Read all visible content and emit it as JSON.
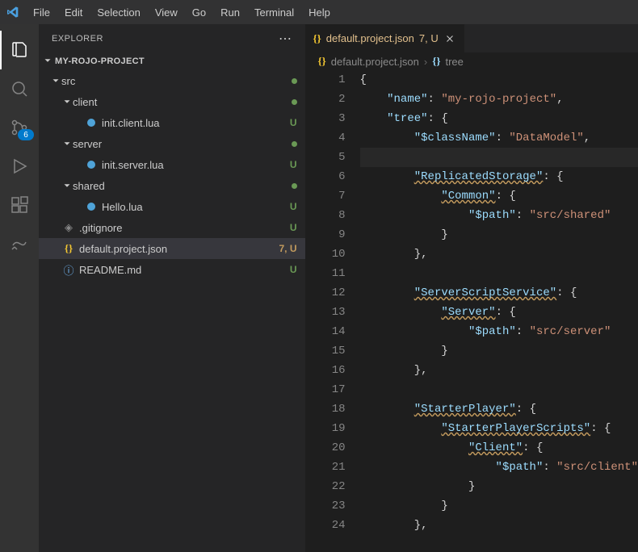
{
  "menu": [
    "File",
    "Edit",
    "Selection",
    "View",
    "Go",
    "Run",
    "Terminal",
    "Help"
  ],
  "activitybar": {
    "scm_badge": "6"
  },
  "explorer": {
    "title": "EXPLORER",
    "project": "MY-ROJO-PROJECT",
    "tree": [
      {
        "type": "folder",
        "label": "src",
        "indent": 1,
        "git": "dot"
      },
      {
        "type": "folder",
        "label": "client",
        "indent": 2,
        "git": "dot"
      },
      {
        "type": "lua",
        "label": "init.client.lua",
        "indent": 3,
        "git": "U"
      },
      {
        "type": "folder",
        "label": "server",
        "indent": 2,
        "git": "dot"
      },
      {
        "type": "lua",
        "label": "init.server.lua",
        "indent": 3,
        "git": "U"
      },
      {
        "type": "folder",
        "label": "shared",
        "indent": 2,
        "git": "dot"
      },
      {
        "type": "lua",
        "label": "Hello.lua",
        "indent": 3,
        "git": "U"
      },
      {
        "type": "gitignore",
        "label": ".gitignore",
        "indent": 1,
        "git": "U"
      },
      {
        "type": "json",
        "label": "default.project.json",
        "indent": 1,
        "git": "7, U",
        "selected": true
      },
      {
        "type": "readme",
        "label": "README.md",
        "indent": 1,
        "git": "U"
      }
    ]
  },
  "tab": {
    "icon": "json",
    "name": "default.project.json",
    "status": "7, U"
  },
  "breadcrumb": {
    "file": "default.project.json",
    "symbol": "tree"
  },
  "code": {
    "lines": [
      {
        "n": 1,
        "t": [
          [
            "p",
            "{"
          ]
        ]
      },
      {
        "n": 2,
        "t": [
          [
            "p",
            "    "
          ],
          [
            "k",
            "\"name\""
          ],
          [
            "p",
            ": "
          ],
          [
            "s",
            "\"my-rojo-project\""
          ],
          [
            "p",
            ","
          ]
        ]
      },
      {
        "n": 3,
        "t": [
          [
            "p",
            "    "
          ],
          [
            "k",
            "\"tree\""
          ],
          [
            "p",
            ": {"
          ]
        ]
      },
      {
        "n": 4,
        "t": [
          [
            "p",
            "        "
          ],
          [
            "k",
            "\"$className\""
          ],
          [
            "p",
            ": "
          ],
          [
            "s",
            "\"DataModel\""
          ],
          [
            "p",
            ","
          ]
        ]
      },
      {
        "n": 5,
        "hl": true,
        "t": [
          [
            "p",
            ""
          ]
        ]
      },
      {
        "n": 6,
        "t": [
          [
            "p",
            "        "
          ],
          [
            "kq",
            "\"ReplicatedStorage\""
          ],
          [
            "p",
            ": {"
          ]
        ]
      },
      {
        "n": 7,
        "t": [
          [
            "p",
            "            "
          ],
          [
            "kq",
            "\"Common\""
          ],
          [
            "p",
            ": {"
          ]
        ]
      },
      {
        "n": 8,
        "t": [
          [
            "p",
            "                "
          ],
          [
            "k",
            "\"$path\""
          ],
          [
            "p",
            ": "
          ],
          [
            "s",
            "\"src/shared\""
          ]
        ]
      },
      {
        "n": 9,
        "t": [
          [
            "p",
            "            }"
          ]
        ]
      },
      {
        "n": 10,
        "t": [
          [
            "p",
            "        },"
          ]
        ]
      },
      {
        "n": 11,
        "t": [
          [
            "p",
            ""
          ]
        ]
      },
      {
        "n": 12,
        "t": [
          [
            "p",
            "        "
          ],
          [
            "kq",
            "\"ServerScriptService\""
          ],
          [
            "p",
            ": {"
          ]
        ]
      },
      {
        "n": 13,
        "t": [
          [
            "p",
            "            "
          ],
          [
            "kq",
            "\"Server\""
          ],
          [
            "p",
            ": {"
          ]
        ]
      },
      {
        "n": 14,
        "t": [
          [
            "p",
            "                "
          ],
          [
            "k",
            "\"$path\""
          ],
          [
            "p",
            ": "
          ],
          [
            "s",
            "\"src/server\""
          ]
        ]
      },
      {
        "n": 15,
        "t": [
          [
            "p",
            "            }"
          ]
        ]
      },
      {
        "n": 16,
        "t": [
          [
            "p",
            "        },"
          ]
        ]
      },
      {
        "n": 17,
        "t": [
          [
            "p",
            ""
          ]
        ]
      },
      {
        "n": 18,
        "t": [
          [
            "p",
            "        "
          ],
          [
            "kq",
            "\"StarterPlayer\""
          ],
          [
            "p",
            ": {"
          ]
        ]
      },
      {
        "n": 19,
        "t": [
          [
            "p",
            "            "
          ],
          [
            "kq",
            "\"StarterPlayerScripts\""
          ],
          [
            "p",
            ": {"
          ]
        ]
      },
      {
        "n": 20,
        "t": [
          [
            "p",
            "                "
          ],
          [
            "kq",
            "\"Client\""
          ],
          [
            "p",
            ": {"
          ]
        ]
      },
      {
        "n": 21,
        "t": [
          [
            "p",
            "                    "
          ],
          [
            "k",
            "\"$path\""
          ],
          [
            "p",
            ": "
          ],
          [
            "s",
            "\"src/client\""
          ]
        ]
      },
      {
        "n": 22,
        "t": [
          [
            "p",
            "                }"
          ]
        ]
      },
      {
        "n": 23,
        "t": [
          [
            "p",
            "            }"
          ]
        ]
      },
      {
        "n": 24,
        "t": [
          [
            "p",
            "        },"
          ]
        ]
      }
    ]
  }
}
